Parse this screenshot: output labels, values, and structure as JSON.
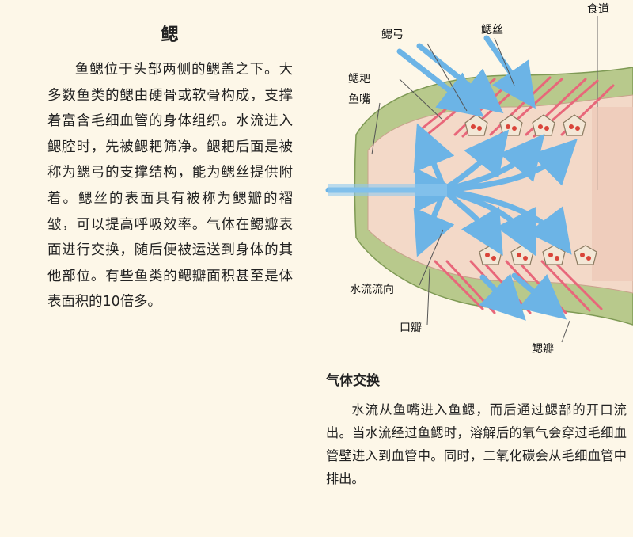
{
  "article": {
    "title": "鳃",
    "body": "鱼鳃位于头部两侧的鳃盖之下。大多数鱼类的鳃由硬骨或软骨构成，支撑着富含毛细血管的身体组织。水流进入鳃腔时，先被鳃耙筛净。鳃耙后面是被称为鳃弓的支撑结构，能为鳃丝提供附着。鳃丝的表面具有被称为鳃瓣的褶皱，可以提高呼吸效率。气体在鳃瓣表面进行交换，随后便被运送到身体的其他部位。有些鱼类的鳃瓣面积甚至是体表面积的10倍多。"
  },
  "figure": {
    "labels": {
      "gill_arch": "鳃弓",
      "gill_filament": "鳃丝",
      "esophagus": "食道",
      "gill_raker": "鳃耙",
      "mouth": "鱼嘴",
      "water_flow": "水流流向",
      "opening": "口瓣",
      "lamella": "鳃瓣"
    },
    "colors": {
      "body_outline": "#b8c98c",
      "inner_cavity": "#f3d9c8",
      "filament_red": "#e8677a",
      "water_arrow": "#6cb4e6",
      "arch_fill": "#f3e7d6"
    }
  },
  "caption": {
    "title": "气体交换",
    "body": "水流从鱼嘴进入鱼鳃，而后通过鳃部的开口流出。当水流经过鱼鳃时，溶解后的氧气会穿过毛细血管壁进入到血管中。同时，二氧化碳会从毛细血管中排出。"
  }
}
